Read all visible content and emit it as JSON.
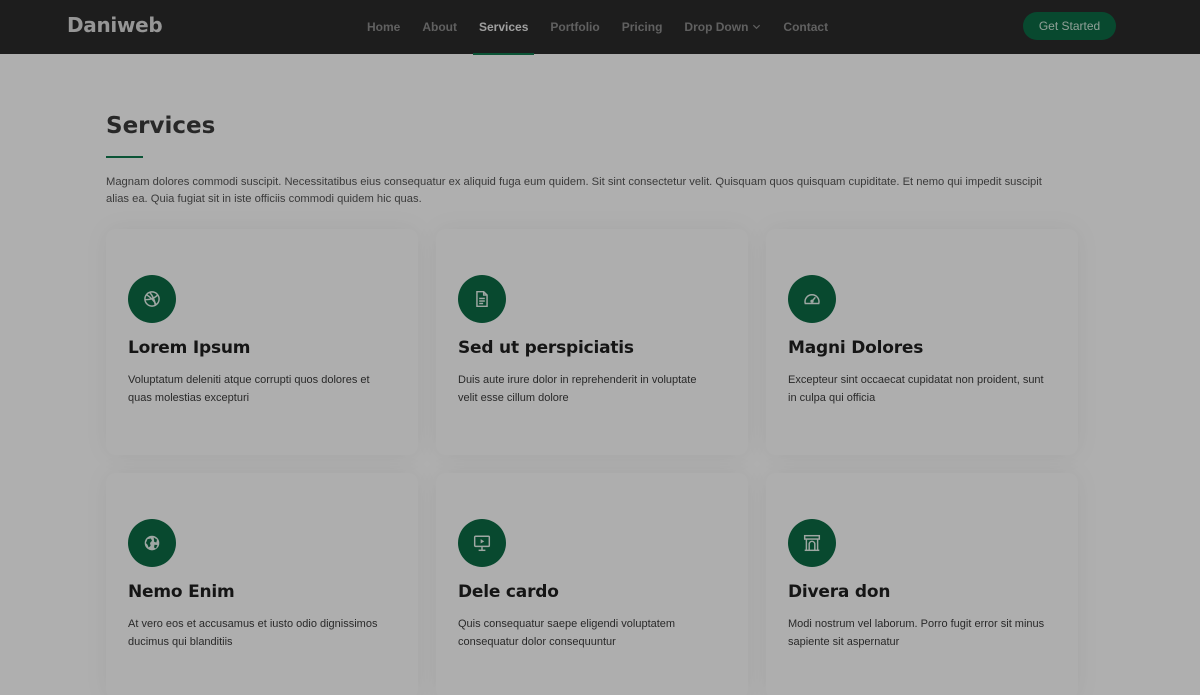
{
  "header": {
    "logo": "Daniweb",
    "nav": [
      {
        "label": "Home"
      },
      {
        "label": "About"
      },
      {
        "label": "Services"
      },
      {
        "label": "Portfolio"
      },
      {
        "label": "Pricing"
      },
      {
        "label": "Drop Down"
      },
      {
        "label": "Contact"
      }
    ],
    "active_item": "Services",
    "cta_label": "Get Started"
  },
  "section": {
    "title": "Services",
    "description": "Magnam dolores commodi suscipit. Necessitatibus eius consequatur ex aliquid fuga eum quidem. Sit sint consectetur velit. Quisquam quos quisquam cupiditate. Et nemo qui impedit suscipit alias ea. Quia fugiat sit in iste officiis commodi quidem hic quas."
  },
  "services": [
    {
      "title": "Lorem Ipsum",
      "text": "Voluptatum deleniti atque corrupti quos dolores et quas molestias excepturi",
      "icon": "dribbble-icon"
    },
    {
      "title": "Sed ut perspiciatis",
      "text": "Duis aute irure dolor in reprehenderit in voluptate velit esse cillum dolore",
      "icon": "file-text-icon"
    },
    {
      "title": "Magni Dolores",
      "text": "Excepteur sint occaecat cupidatat non proident, sunt in culpa qui officia",
      "icon": "speedometer-icon"
    },
    {
      "title": "Nemo Enim",
      "text": "At vero eos et accusamus et iusto odio dignissimos ducimus qui blanditiis",
      "icon": "globe-icon"
    },
    {
      "title": "Dele cardo",
      "text": "Quis consequatur saepe eligendi voluptatem consequatur dolor consequuntur",
      "icon": "presentation-icon"
    },
    {
      "title": "Divera don",
      "text": "Modi nostrum vel laborum. Porro fugit error sit minus sapiente sit aspernatur",
      "icon": "arch-icon"
    }
  ],
  "colors": {
    "accent": "#0c6b45",
    "header_bg": "#2b2b2b",
    "overlay": "rgba(0,0,0,0.31)"
  }
}
